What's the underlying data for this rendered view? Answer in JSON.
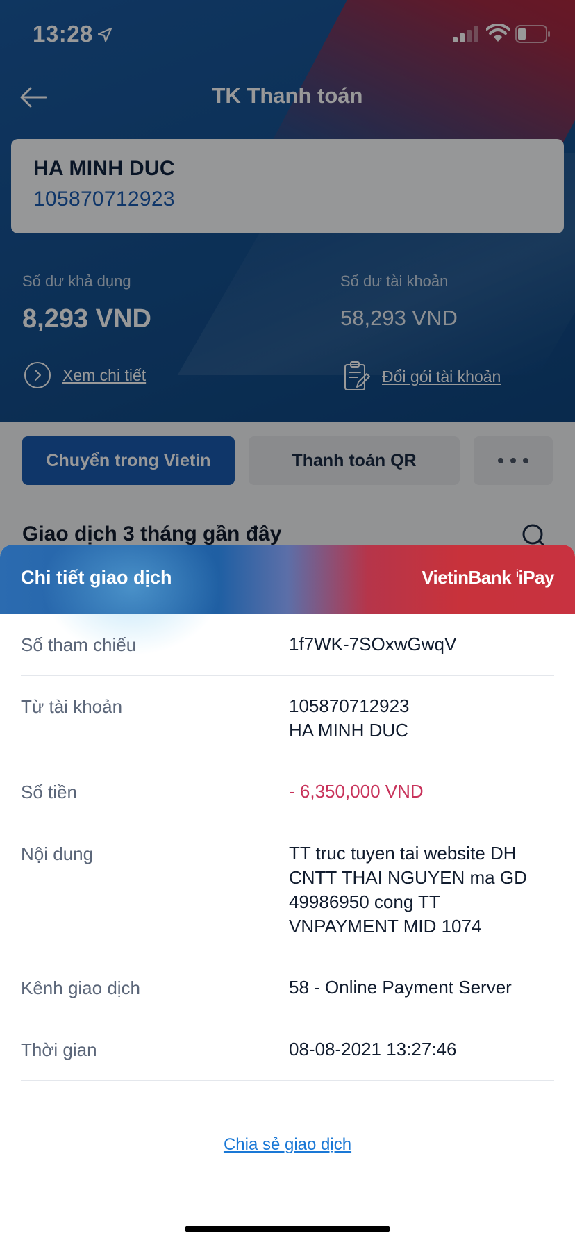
{
  "status_bar": {
    "time": "13:28"
  },
  "nav": {
    "title": "TK Thanh toán"
  },
  "account": {
    "name": "HA MINH DUC",
    "number": "105870712923"
  },
  "balances": {
    "available_label": "Số dư khả dụng",
    "available_value": "8,293 VND",
    "account_label": "Số dư tài khoản",
    "account_value": "58,293 VND"
  },
  "links": {
    "view_detail": "Xem chi tiết",
    "change_package": "Đổi gói tài khoản"
  },
  "actions": {
    "transfer": "Chuyển trong Vietin",
    "qr_payment": "Thanh toán QR"
  },
  "section": {
    "title": "Giao dịch 3 tháng gần đây"
  },
  "sheet": {
    "title": "Chi tiết giao dịch",
    "brand": "VietinBank",
    "brand_suffix": "iPay",
    "rows": [
      {
        "label": "Số tham chiếu",
        "value": "1f7WK-7SOxwGwqV"
      },
      {
        "label": "Từ tài khoản",
        "value_line1": "105870712923",
        "value_line2": "HA MINH DUC"
      },
      {
        "label": "Số tiền",
        "value": "- 6,350,000 VND"
      },
      {
        "label": "Nội dung",
        "value": "TT truc tuyen tai website DH CNTT THAI NGUYEN ma GD 49986950 cong TT VNPAYMENT MID 1074"
      },
      {
        "label": "Kênh giao dịch",
        "value": "58 - Online Payment Server"
      },
      {
        "label": "Thời gian",
        "value": "08-08-2021 13:27:46"
      }
    ],
    "share_label": "Chia sẻ giao dịch"
  },
  "colors": {
    "primary_blue": "#1a5bb0",
    "brand_red": "#c8242f",
    "negative_amount": "#c8325a",
    "link_blue": "#1a78d6"
  }
}
